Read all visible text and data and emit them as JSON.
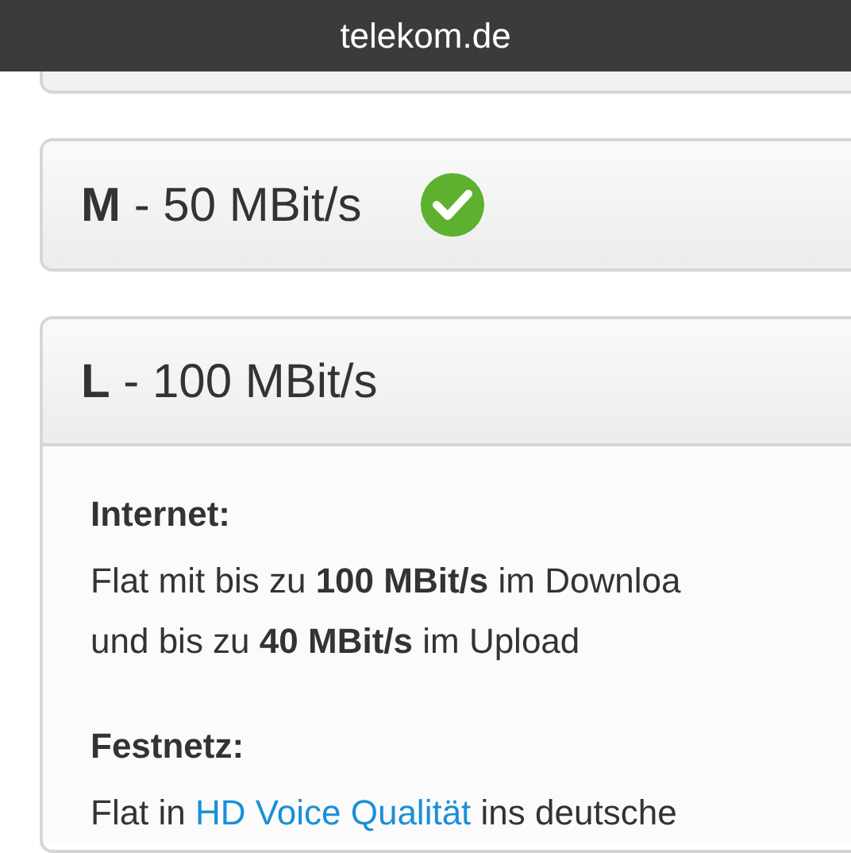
{
  "address_bar": {
    "url": "telekom.de"
  },
  "plans": [
    {
      "letter": "M",
      "speed": " - 50 MBit/s",
      "selected": true,
      "expanded": false
    },
    {
      "letter": "L",
      "speed": " - 100 MBit/s",
      "selected": false,
      "expanded": true,
      "sections": [
        {
          "heading": "Internet:",
          "lines": [
            "Flat mit bis zu **100 MBit/s** im Downloa",
            "und bis zu **40 MBit/s** im Upload"
          ]
        },
        {
          "heading": "Festnetz:",
          "parts": [
            {
              "text": "Flat in ",
              "link": false
            },
            {
              "text": "HD Voice Qualität",
              "link": true
            },
            {
              "text": " ins deutsche",
              "link": false
            }
          ]
        }
      ]
    }
  ]
}
